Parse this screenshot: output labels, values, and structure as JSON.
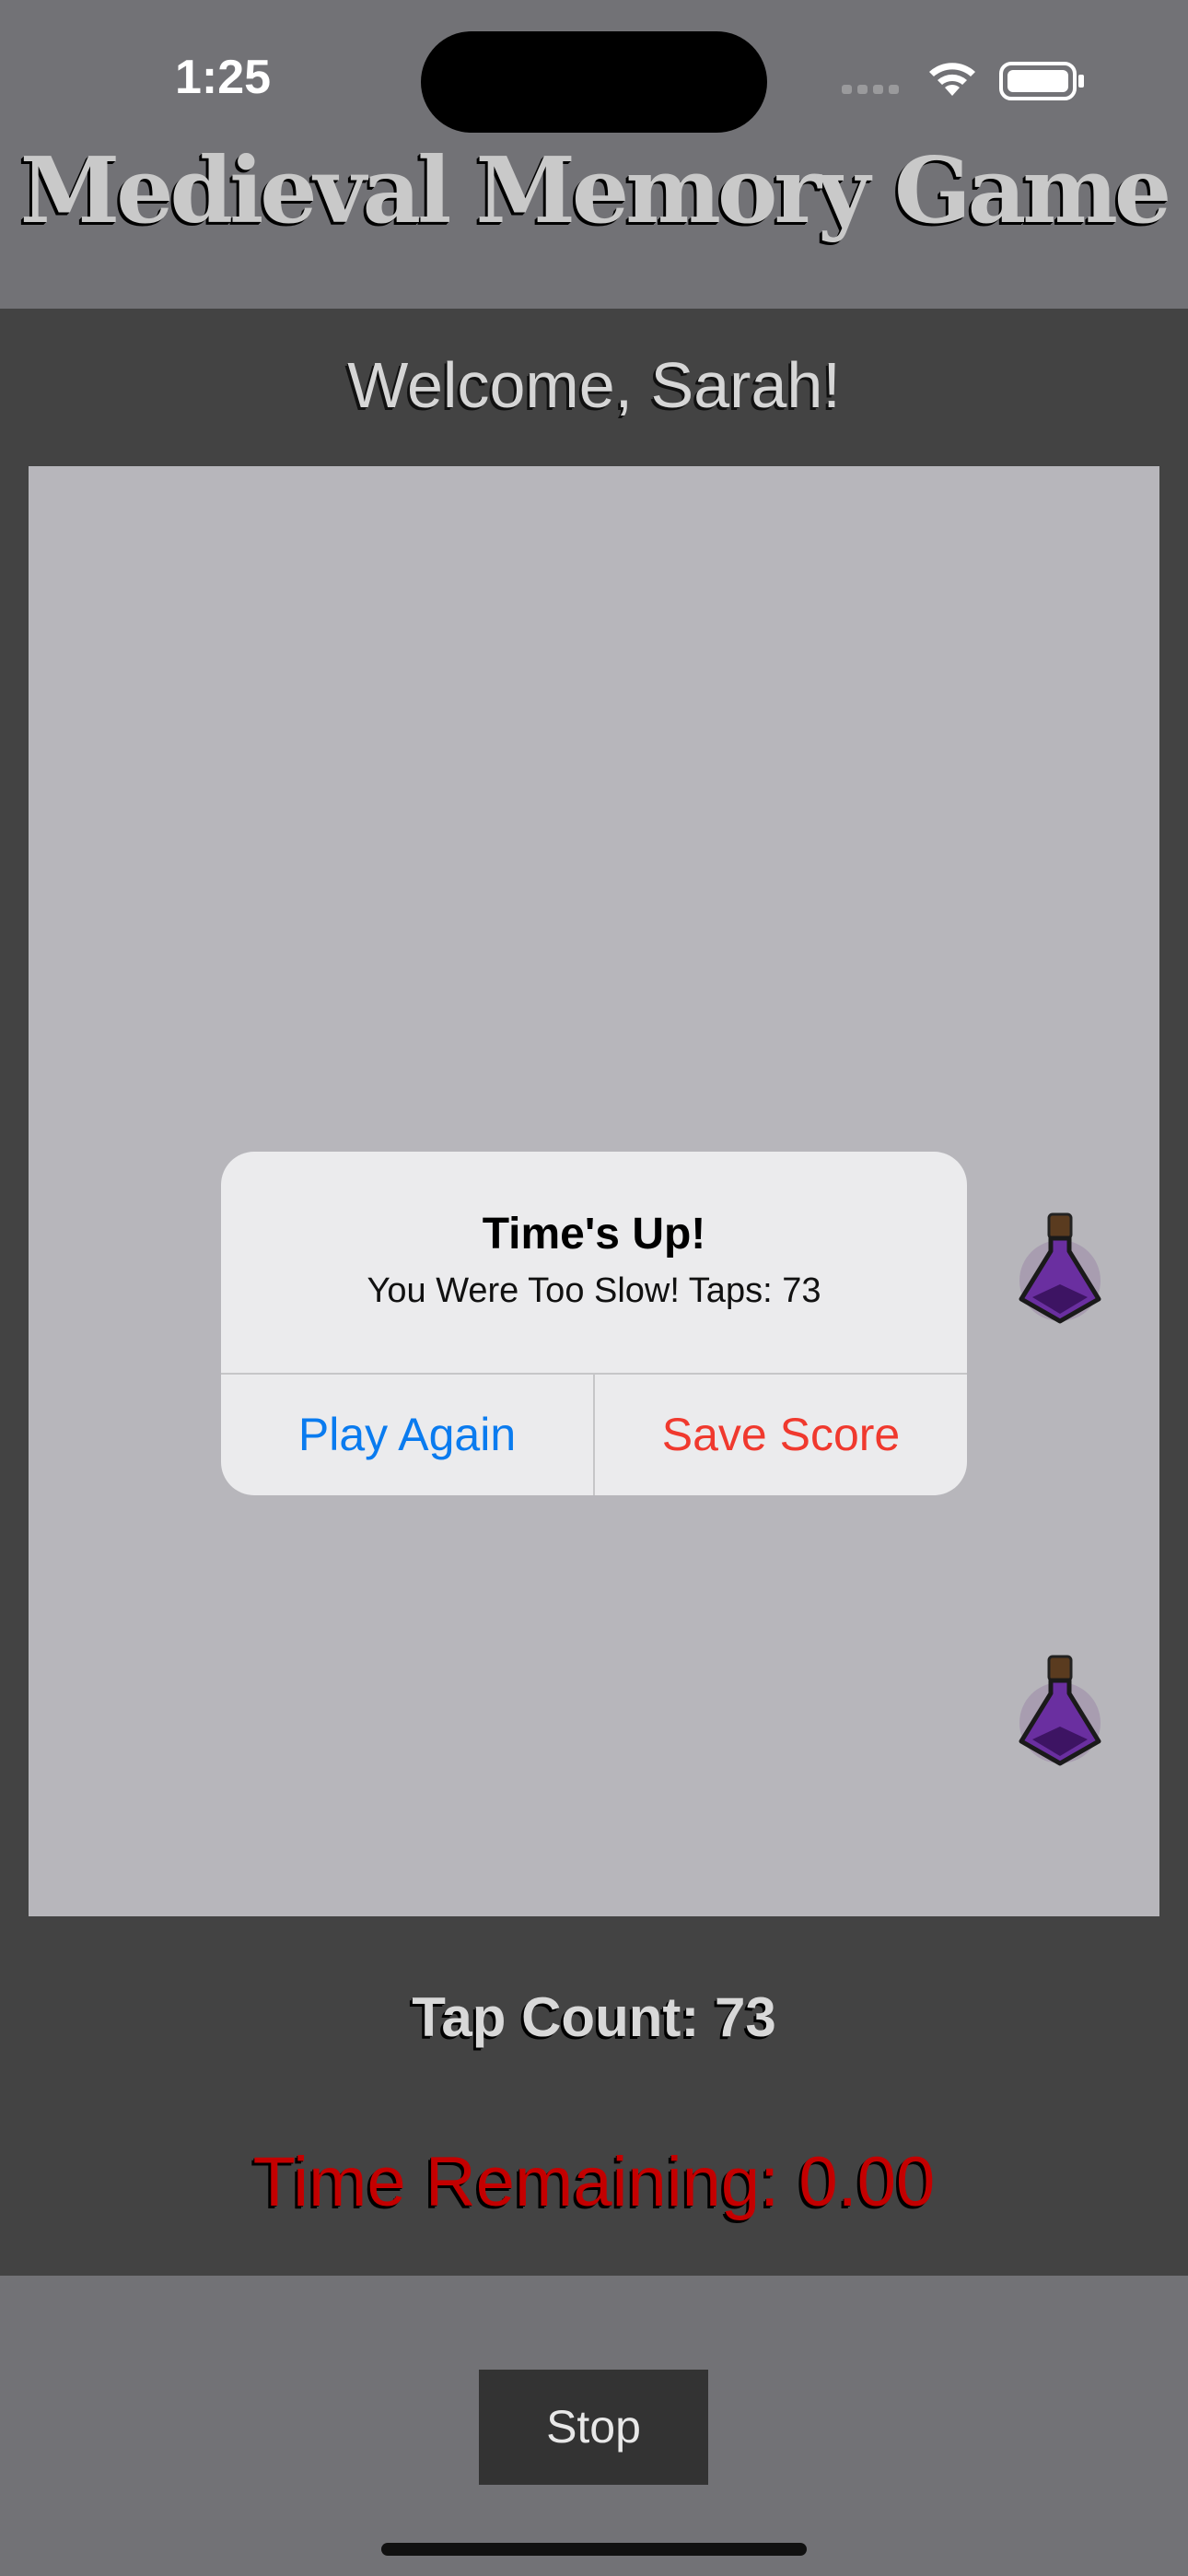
{
  "status_bar": {
    "time": "1:25"
  },
  "header": {
    "title": "Medieval Memory Game"
  },
  "welcome": {
    "text": "Welcome, Sarah!"
  },
  "alert": {
    "title": "Time's Up!",
    "message": "You Were Too Slow! Taps: 73",
    "primary_button": "Play Again",
    "secondary_button": "Save Score"
  },
  "stats": {
    "tap_count": "Tap Count: 73",
    "time_remaining": "Time Remaining: 0.00"
  },
  "controls": {
    "stop_label": "Stop"
  },
  "board": {
    "item_icon": "potion-icon"
  },
  "colors": {
    "header_bg": "#727276",
    "panel_bg": "#434343",
    "board_bg": "#b7b6bb",
    "alert_play": "#0a7bef",
    "alert_save": "#f0392e",
    "timer_red": "#c40000"
  }
}
